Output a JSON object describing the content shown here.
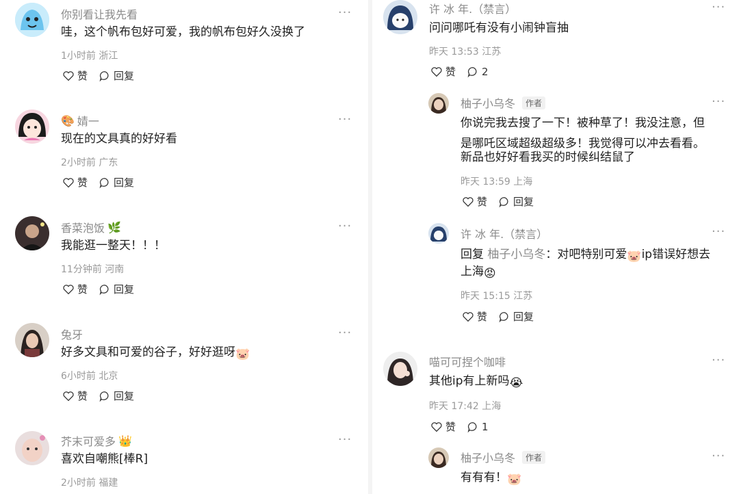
{
  "left": [
    {
      "user": "你别看让我先看",
      "text": "哇，这个帆布包好可爱，我的帆布包好久没换了",
      "time": "1小时前",
      "loc": "浙江"
    },
    {
      "user": "婧一",
      "text": "现在的文具真的好好看",
      "time": "2小时前",
      "loc": "广东"
    },
    {
      "user": "香菜泡饭",
      "text": "我能逛一整天！！！",
      "time": "11分钟前",
      "loc": "河南"
    },
    {
      "user": "兔牙",
      "text": "好多文具和可爱的谷子，好好逛呀",
      "time": "6小时前",
      "loc": "北京"
    },
    {
      "user": "芥末可爱多",
      "text": "喜欢自嘲熊[棒R]",
      "time": "2小时前",
      "loc": "福建"
    }
  ],
  "right": {
    "c1": {
      "user": "许 冰 年.（禁言）",
      "text": "问问哪吒有没有小闹钟盲抽",
      "time": "昨天 13:53",
      "loc": "江苏",
      "reply_count": "2"
    },
    "r1": {
      "user": "柚子小乌冬",
      "tag": "作者",
      "lines": [
        "你说完我去搜了一下！被种草了！我没注意，但",
        "是哪吒区域超级超级多！我觉得可以冲去看看。",
        "新品也好好看我买的时候纠结鼠了"
      ],
      "time": "昨天 13:59",
      "loc": "上海"
    },
    "r2": {
      "user": "许 冰 年.（禁言）",
      "reply_label": "回复",
      "reply_target": "柚子小乌冬",
      "line1": "：对吧特别可爱",
      "line1b": "ip错误好想去",
      "line2": "上海",
      "time": "昨天 15:15",
      "loc": "江苏"
    },
    "c2": {
      "user": "喵可可捏个咖啡",
      "text": "其他ip有上新吗",
      "time": "昨天 17:42",
      "loc": "上海",
      "reply_count": "1"
    },
    "r3": {
      "user": "柚子小乌冬",
      "tag": "作者",
      "text": "有有有！"
    }
  },
  "labels": {
    "like": "赞",
    "reply": "回复",
    "more": "···"
  },
  "colors": {
    "text": "#1f1f1f",
    "muted": "#8a8a8a",
    "meta": "#9a9a9a"
  }
}
